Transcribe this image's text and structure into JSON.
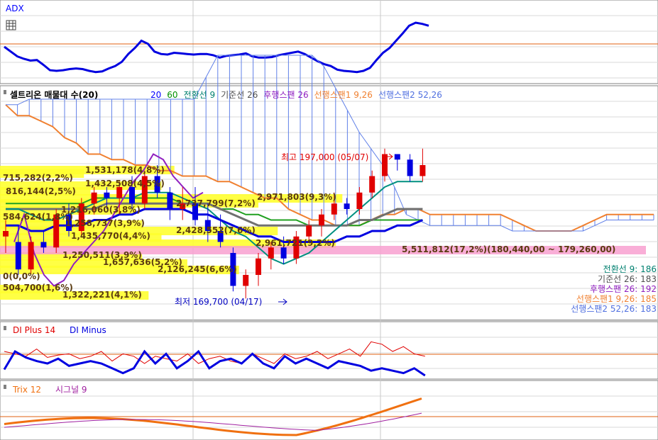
{
  "panels": {
    "adx": {
      "title": "ADX",
      "title_color": "#0000ff",
      "series": [
        {
          "name": "ADX",
          "color": "#0000e0",
          "y": [
            60,
            68,
            76,
            80,
            83,
            82,
            90,
            99,
            100,
            99,
            97,
            96,
            97,
            100,
            102,
            101,
            96,
            92,
            85,
            72,
            62,
            50,
            55,
            68,
            72,
            73,
            70,
            71,
            72,
            73,
            72,
            72,
            74,
            78,
            75,
            74,
            73,
            71,
            76,
            78,
            78,
            77,
            74,
            72,
            70,
            68,
            72,
            78,
            84,
            89,
            92,
            98,
            100,
            101,
            102,
            100,
            95,
            82,
            70,
            62,
            50,
            38,
            25,
            20,
            22,
            25
          ]
        }
      ],
      "ref_line": {
        "y": 62,
        "color": "#e06010"
      }
    },
    "ichimoku": {
      "title": "셀트리온 매물대 수(20)",
      "legend": [
        {
          "label": "20",
          "color": "#0000ff"
        },
        {
          "label": "60",
          "color": "#009000"
        },
        {
          "label": "전환선 9",
          "color": "#008070"
        },
        {
          "label": "기준선 26",
          "color": "#505050"
        },
        {
          "label": "후행스팬 26",
          "color": "#9020c0"
        },
        {
          "label": "선행스팬1 9,26",
          "color": "#f08030"
        },
        {
          "label": "선행스팬2 52,26",
          "color": "#5070e0"
        }
      ],
      "volume_profile": [
        {
          "label": "715,282(2,2%)",
          "bar_frac": 0.13
        },
        {
          "label": "816,144(2,5%)",
          "bar_frac": 0.14
        },
        {
          "label": "1,531,178(4,8%)",
          "bar_frac": 0.27
        },
        {
          "label": "1,432,508(4,5%)",
          "bar_frac": 0.25
        },
        {
          "label": "1,216,060(3,8%)",
          "bar_frac": 0.21
        },
        {
          "label": "584,624(1,8%)",
          "bar_frac": 0.1
        },
        {
          "label": "1,258,737(3,9%)",
          "bar_frac": 0.22
        },
        {
          "label": "2,737,799(7,2%)",
          "bar_frac": 0.4
        },
        {
          "label": "2,971,803(9,3%)",
          "bar_frac": 0.53
        },
        {
          "label": "1,435,770(4,4%)",
          "bar_frac": 0.25
        },
        {
          "label": "2,428,552(7,6%)",
          "bar_frac": 0.43
        },
        {
          "label": "2,961,721(9,2%)",
          "bar_frac": 0.52
        },
        {
          "label": "1,250,511(3,9%)",
          "bar_frac": 0.22
        },
        {
          "label": "1,657,636(5,2%)",
          "bar_frac": 0.29
        },
        {
          "label": "5,511,812(17,2%)(180,440,00 ~ 179,260,00)",
          "bar_frac": 1.0
        },
        {
          "label": "2,126,245(6,6%)",
          "bar_frac": 0.37
        },
        {
          "label": "0(0,0%)",
          "bar_frac": 0.0
        },
        {
          "label": "504,700(1,6%)",
          "bar_frac": 0.09
        },
        {
          "label": "1,322,221(4,1%)",
          "bar_frac": 0.23
        }
      ],
      "annotations": {
        "high": {
          "text": "최고 197,000 (05/07)",
          "color": "#e00000"
        },
        "low": {
          "text": "최저 169,700 (04/17)",
          "color": "#0000c0"
        }
      },
      "right_values": [
        {
          "label": "전환선 9: 186",
          "color": "#008070"
        },
        {
          "label": "기준선 26: 183",
          "color": "#505050"
        },
        {
          "label": "후행스팬 26: 192",
          "color": "#9020c0"
        },
        {
          "label": "선행스팬1 9,26: 185",
          "color": "#f08030"
        },
        {
          "label": "선행스팬2 52,26: 183",
          "color": "#5070e0"
        }
      ]
    },
    "dmi": {
      "title_plus": "DI Plus 14",
      "title_minus": "DI Minus",
      "plus_color": "#e00000",
      "minus_color": "#0000e0",
      "ref_line_color": "#e06010"
    },
    "trix": {
      "title": "Trix 12",
      "signal_title": "시그널 9",
      "trix_color": "#f07010",
      "signal_color": "#a020a0"
    }
  },
  "chart_data": {
    "type": "line",
    "panels": [
      {
        "name": "ichimoku",
        "candles": [
          {
            "o": 181,
            "h": 184,
            "l": 178,
            "c": 182
          },
          {
            "o": 180,
            "h": 183,
            "l": 174,
            "c": 175
          },
          {
            "o": 175,
            "h": 181,
            "l": 174,
            "c": 180
          },
          {
            "o": 180,
            "h": 182,
            "l": 178,
            "c": 179
          },
          {
            "o": 179,
            "h": 186,
            "l": 178,
            "c": 185
          },
          {
            "o": 185,
            "h": 187,
            "l": 181,
            "c": 182
          },
          {
            "o": 182,
            "h": 188,
            "l": 181,
            "c": 187
          },
          {
            "o": 187,
            "h": 190,
            "l": 185,
            "c": 189
          },
          {
            "o": 189,
            "h": 190,
            "l": 186,
            "c": 188
          },
          {
            "o": 188,
            "h": 191,
            "l": 185,
            "c": 190
          },
          {
            "o": 190,
            "h": 192,
            "l": 186,
            "c": 187
          },
          {
            "o": 187,
            "h": 193,
            "l": 186,
            "c": 192
          },
          {
            "o": 192,
            "h": 194,
            "l": 188,
            "c": 189
          },
          {
            "o": 189,
            "h": 190,
            "l": 184,
            "c": 186
          },
          {
            "o": 186,
            "h": 190,
            "l": 184,
            "c": 187
          },
          {
            "o": 187,
            "h": 190,
            "l": 183,
            "c": 184
          },
          {
            "o": 184,
            "h": 187,
            "l": 180,
            "c": 182
          },
          {
            "o": 182,
            "h": 185,
            "l": 179,
            "c": 180
          },
          {
            "o": 178,
            "h": 179,
            "l": 171,
            "c": 172
          },
          {
            "o": 172,
            "h": 175,
            "l": 169.7,
            "c": 174
          },
          {
            "o": 174,
            "h": 178,
            "l": 172,
            "c": 177
          },
          {
            "o": 177,
            "h": 180,
            "l": 175,
            "c": 179
          },
          {
            "o": 179,
            "h": 181,
            "l": 176,
            "c": 177
          },
          {
            "o": 177,
            "h": 182,
            "l": 176,
            "c": 181
          },
          {
            "o": 181,
            "h": 184,
            "l": 180,
            "c": 183
          },
          {
            "o": 183,
            "h": 186,
            "l": 181,
            "c": 185
          },
          {
            "o": 185,
            "h": 189,
            "l": 184,
            "c": 187
          },
          {
            "o": 187,
            "h": 188,
            "l": 185,
            "c": 186
          },
          {
            "o": 186,
            "h": 190,
            "l": 185,
            "c": 189
          },
          {
            "o": 189,
            "h": 193,
            "l": 188,
            "c": 192
          },
          {
            "o": 192,
            "h": 197,
            "l": 191,
            "c": 196
          },
          {
            "o": 196,
            "h": 196,
            "l": 193,
            "c": 195
          },
          {
            "o": 195,
            "h": 196,
            "l": 191,
            "c": 192
          },
          {
            "o": 192,
            "h": 197,
            "l": 191,
            "c": 194
          }
        ]
      }
    ]
  }
}
